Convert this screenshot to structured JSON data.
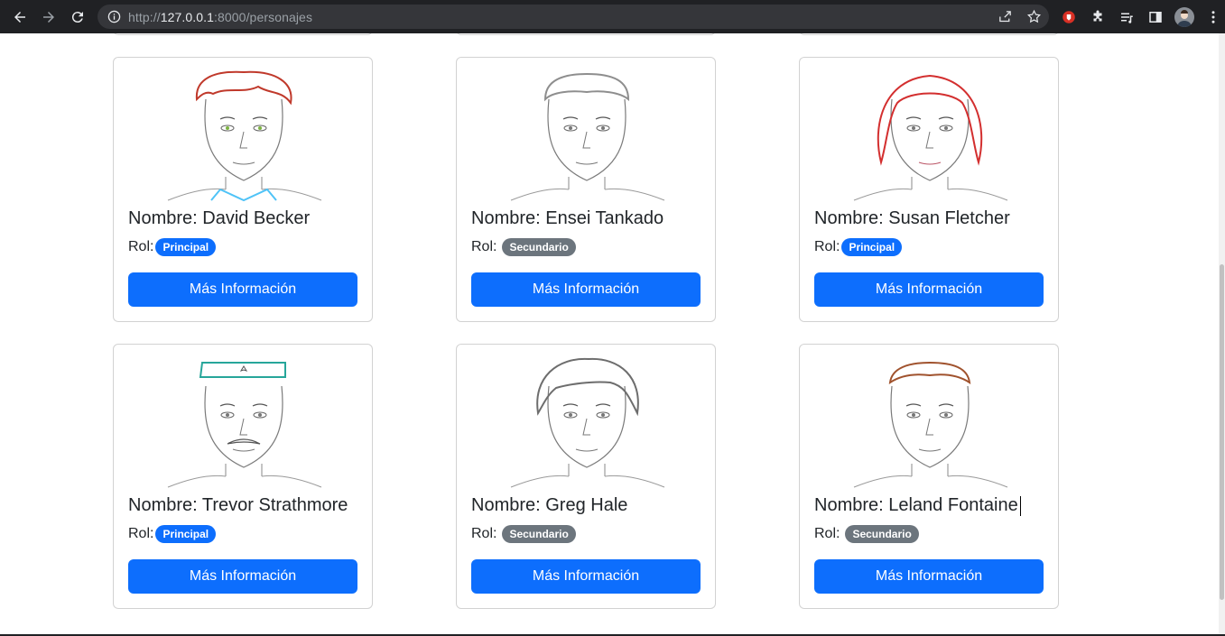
{
  "browser": {
    "url_scheme": "http://",
    "url_host": "127.0.0.1",
    "url_rest": ":8000/personajes"
  },
  "cards": [
    {
      "name": "Nombre: David Becker",
      "rol_label": "Rol:",
      "badge": "Principal",
      "badge_type": "principal",
      "button": "Más Información",
      "sketch_color": "#c0392b",
      "accent": "#4fc3f7"
    },
    {
      "name": "Nombre: Ensei Tankado",
      "rol_label": "Rol:",
      "badge": "Secundario",
      "badge_type": "secundario",
      "button": "Más Información",
      "sketch_color": "#8e8e8e",
      "accent": "#9e9e9e"
    },
    {
      "name": "Nombre: Susan Fletcher",
      "rol_label": "Rol:",
      "badge": "Principal",
      "badge_type": "principal",
      "button": "Más Información",
      "sketch_color": "#d32f2f",
      "accent": "#d32f2f"
    },
    {
      "name": "Nombre: Trevor Strathmore",
      "rol_label": "Rol:",
      "badge": "Principal",
      "badge_type": "principal",
      "button": "Más Información",
      "sketch_color": "#6d6d6d",
      "accent": "#26a69a"
    },
    {
      "name": "Nombre: Greg Hale",
      "rol_label": "Rol:",
      "badge": "Secundario",
      "badge_type": "secundario",
      "button": "Más Información",
      "sketch_color": "#6d6d6d",
      "accent": "#f4d03f"
    },
    {
      "name": "Nombre: Leland Fontaine",
      "rol_label": "Rol:",
      "badge": "Secundario",
      "badge_type": "secundario",
      "button": "Más Información",
      "sketch_color": "#a0522d",
      "accent": "#bcaaa4"
    }
  ],
  "colors": {
    "primary": "#0d6efd",
    "secondary": "#6c757d",
    "chrome_bg": "#202124"
  }
}
